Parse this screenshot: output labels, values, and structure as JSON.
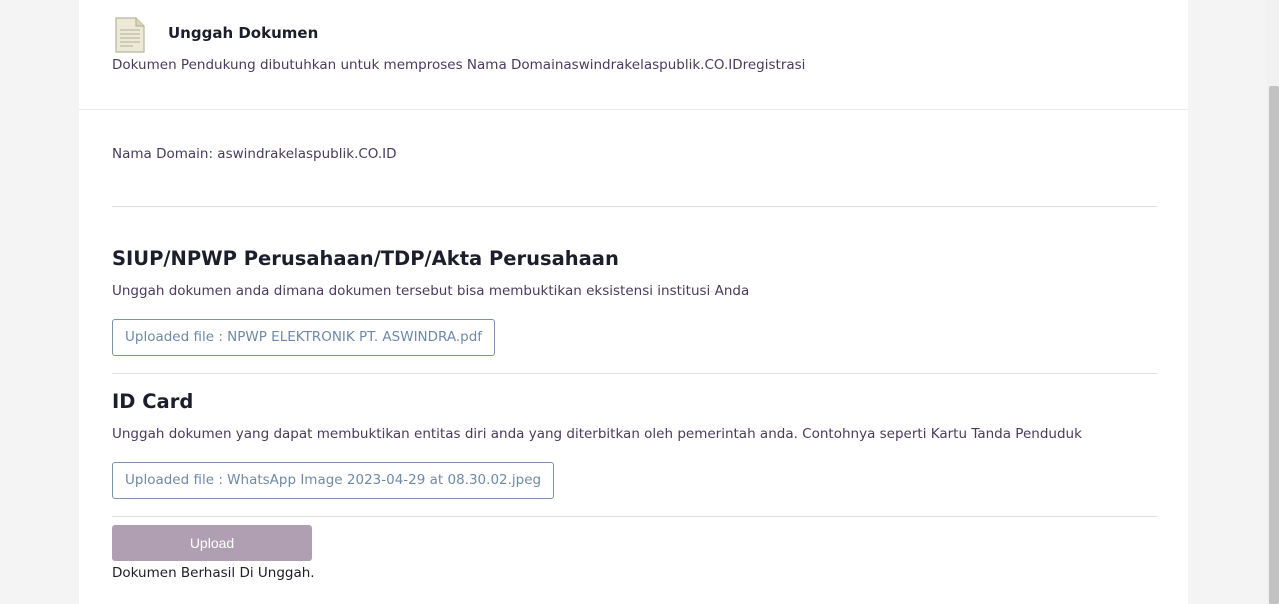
{
  "header": {
    "title": "Unggah Dokumen",
    "subtitle": "Dokumen Pendukung dibutuhkan untuk memproses Nama Domainaswindrakelaspublik.CO.IDregistrasi",
    "icon": "document-icon"
  },
  "domain": {
    "label": "Nama Domain: aswindrakelaspublik.CO.ID"
  },
  "sections": [
    {
      "title": "SIUP/NPWP Perusahaan/TDP/Akta Perusahaan",
      "description": "Unggah dokumen anda dimana dokumen tersebut bisa membuktikan eksistensi institusi Anda",
      "file_label": "Uploaded file : NPWP ELEKTRONIK PT. ASWINDRA.pdf"
    },
    {
      "title": "ID Card",
      "description": "Unggah dokumen yang dapat membuktikan entitas diri anda yang diterbitkan oleh pemerintah anda. Contohnya seperti Kartu Tanda Penduduk",
      "file_label": "Uploaded file : WhatsApp Image 2023-04-29 at 08.30.02.jpeg"
    }
  ],
  "actions": {
    "upload_label": "Upload",
    "success_message": "Dokumen Berhasil Di Unggah."
  },
  "colors": {
    "button": "#b09fb3",
    "file_border": "#7a93b0",
    "text": "#4a3b5c"
  }
}
